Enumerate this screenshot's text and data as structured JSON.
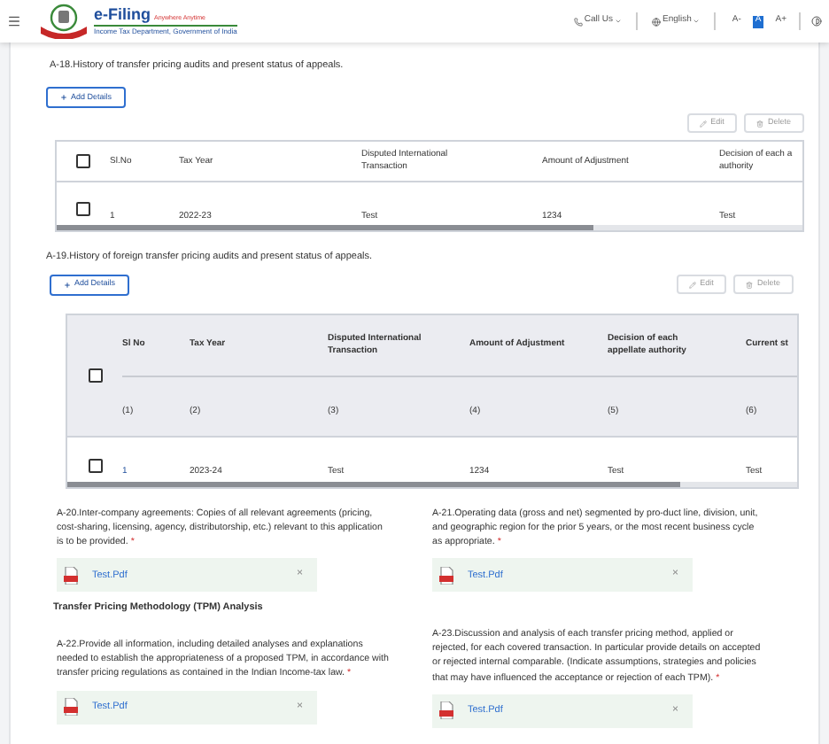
{
  "header": {
    "logo_title": "e-Filing",
    "logo_tagline": "Anywhere Anytime",
    "logo_subtitle": "Income Tax Department, Government of India",
    "call_us": "Call Us",
    "language": "English",
    "font_buttons": [
      {
        "label": "A-",
        "selected": false
      },
      {
        "label": "A",
        "selected": true
      },
      {
        "label": "A+",
        "selected": false
      }
    ]
  },
  "sections": [
    {
      "title": "A-18.History of transfer pricing audits and present status of appeals.",
      "add_button": "Add Details",
      "edit_button": "Edit",
      "delete_button": "Delete",
      "table": {
        "header_checked": false,
        "columns": [
          {
            "lines": [
              "Sl.No"
            ]
          },
          {
            "lines": [
              "Tax Year"
            ]
          },
          {
            "lines": [
              "Disputed International",
              "Transaction"
            ]
          },
          {
            "lines": [
              "Amount of Adjustment"
            ]
          },
          {
            "lines": [
              "Decision of each a",
              "authority"
            ]
          }
        ],
        "rows": [
          {
            "checked": false,
            "cells": [
              "1",
              "2022-23",
              "Test",
              "1234",
              "Test"
            ]
          }
        ]
      }
    },
    {
      "title": "A-19.History of foreign transfer pricing audits and present status of appeals.",
      "add_button": "Add Details",
      "edit_button": "Edit",
      "delete_button": "Delete",
      "table": {
        "header_checked": false,
        "columns": [
          {
            "lines": [
              "Sl No"
            ],
            "index": "(1)"
          },
          {
            "lines": [
              "Tax Year"
            ],
            "index": "(2)"
          },
          {
            "lines": [
              "Disputed International",
              "Transaction"
            ],
            "index": "(3)"
          },
          {
            "lines": [
              "Amount of Adjustment"
            ],
            "index": "(4)"
          },
          {
            "lines": [
              "Decision of each",
              "appellate authority"
            ],
            "index": "(5)"
          },
          {
            "lines": [
              "Current st"
            ],
            "index": "(6)"
          }
        ],
        "rows": [
          {
            "checked": false,
            "cells": [
              "1",
              "2023-24",
              "Test",
              "1234",
              "Test",
              "Test"
            ]
          }
        ]
      }
    }
  ],
  "uploads_1": [
    {
      "question": "A-20.Inter-company agreements: Copies of all relevant agreements (pricing, cost-sharing, licensing, agency, distributorship, etc.) relevant to this application is to be provided.",
      "required_mark": "*",
      "file": "Test.Pdf",
      "remove": "×"
    },
    {
      "question": "A-21.Operating data (gross and net) segmented by pro-duct line, division, unit, and geographic region for the prior 5 years, or the most recent business cycle as appropriate.",
      "required_mark": "*",
      "file": "Test.Pdf",
      "remove": "×"
    }
  ],
  "tpm_heading": "Transfer Pricing Methodology (TPM) Analysis",
  "uploads_2": [
    {
      "question": "A-22.Provide all information, including detailed analyses and explanations needed to establish the appropriateness of a proposed TPM, in accordance with transfer pricing regulations as contained in the Indian Income-tax law.",
      "required_mark": "*",
      "file": "Test.Pdf",
      "remove": "×"
    },
    {
      "question": "A-23.Discussion and analysis of each transfer pricing method, applied or rejected, for each covered transaction. In particular provide details on accepted or rejected internal comparable. (Indicate assumptions, strategies and policies that may have influenced the acceptance or rejection of each TPM).",
      "required_mark": "*",
      "file": "Test.Pdf",
      "remove": "×"
    }
  ]
}
